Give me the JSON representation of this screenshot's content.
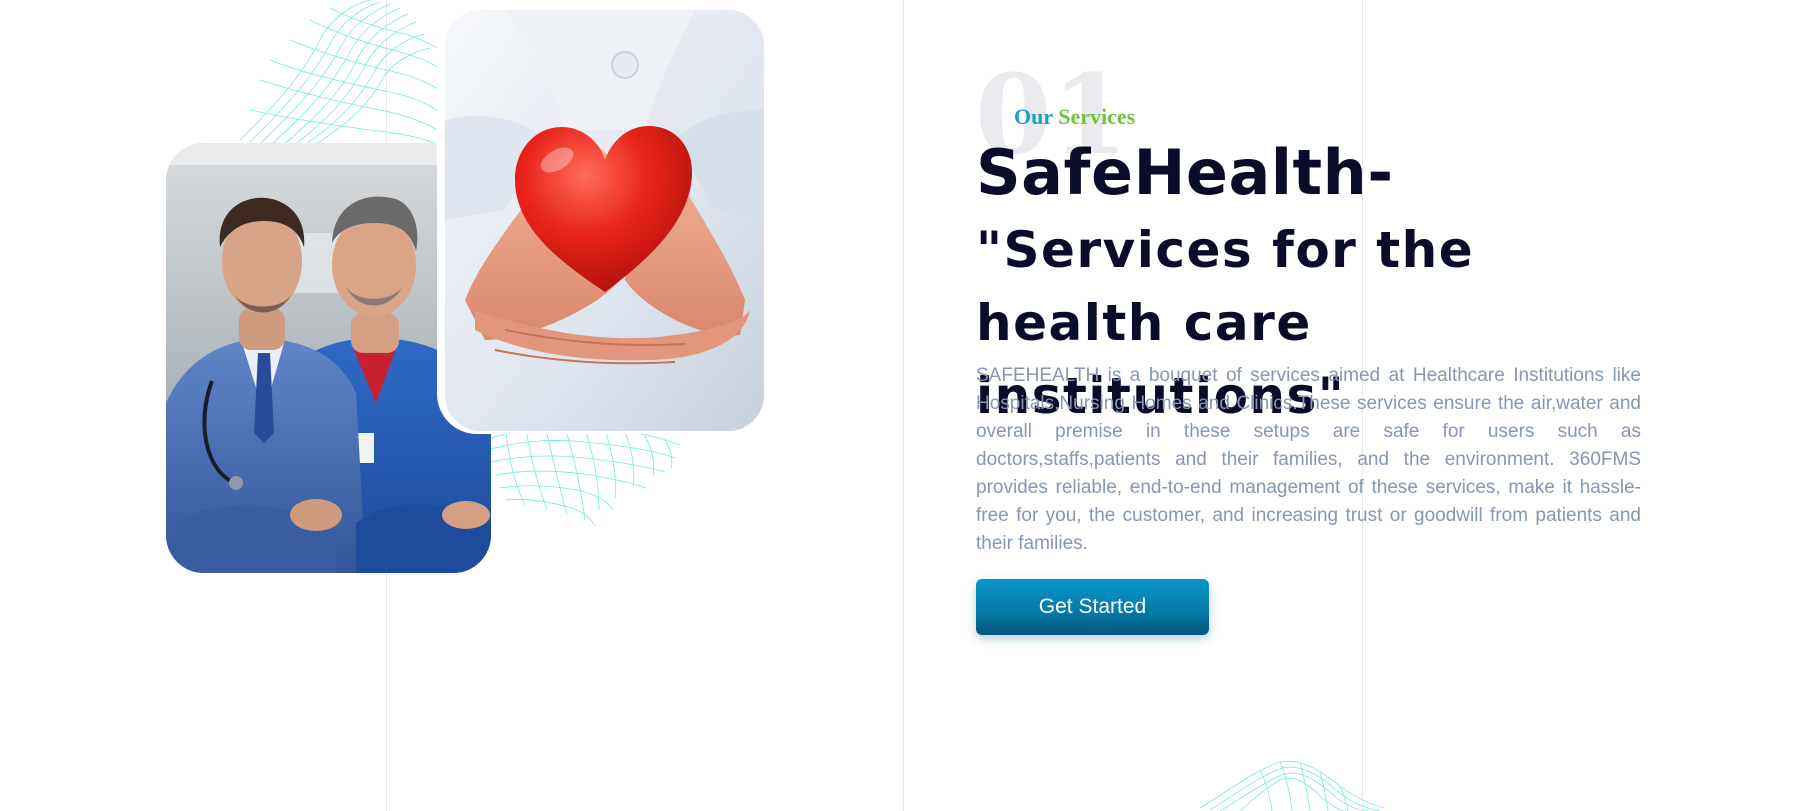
{
  "services": {
    "number": "01",
    "eyebrow_part1": "Our",
    "eyebrow_part2": "Services",
    "headline_brand": "SafeHealth-",
    "headline_rest": "\"Services for the health care institutions\"",
    "description": "SAFEHEALTH is a bouquet of services aimed at Healthcare Institutions like Hospitals,Nursing Homes and Clinics.These services ensure the air,water and overall premise in these setups are safe for users such as doctors,staffs,patients and their families, and the environment. 360FMS provides reliable, end-to-end management of these services, make it hassle-free for you, the customer, and increasing trust or goodwill from patients and their families.",
    "cta_label": "Get Started"
  },
  "colors": {
    "accent": "#0679a7",
    "eyebrow_blue": "#1a9fc5",
    "eyebrow_green": "#72c13d",
    "heading": "#0b0c2a",
    "body_text": "#8796b2",
    "mesh": "#5fe3d6"
  },
  "icons": [
    "mesh-decoration",
    "heart-photo",
    "doctors-photo"
  ]
}
